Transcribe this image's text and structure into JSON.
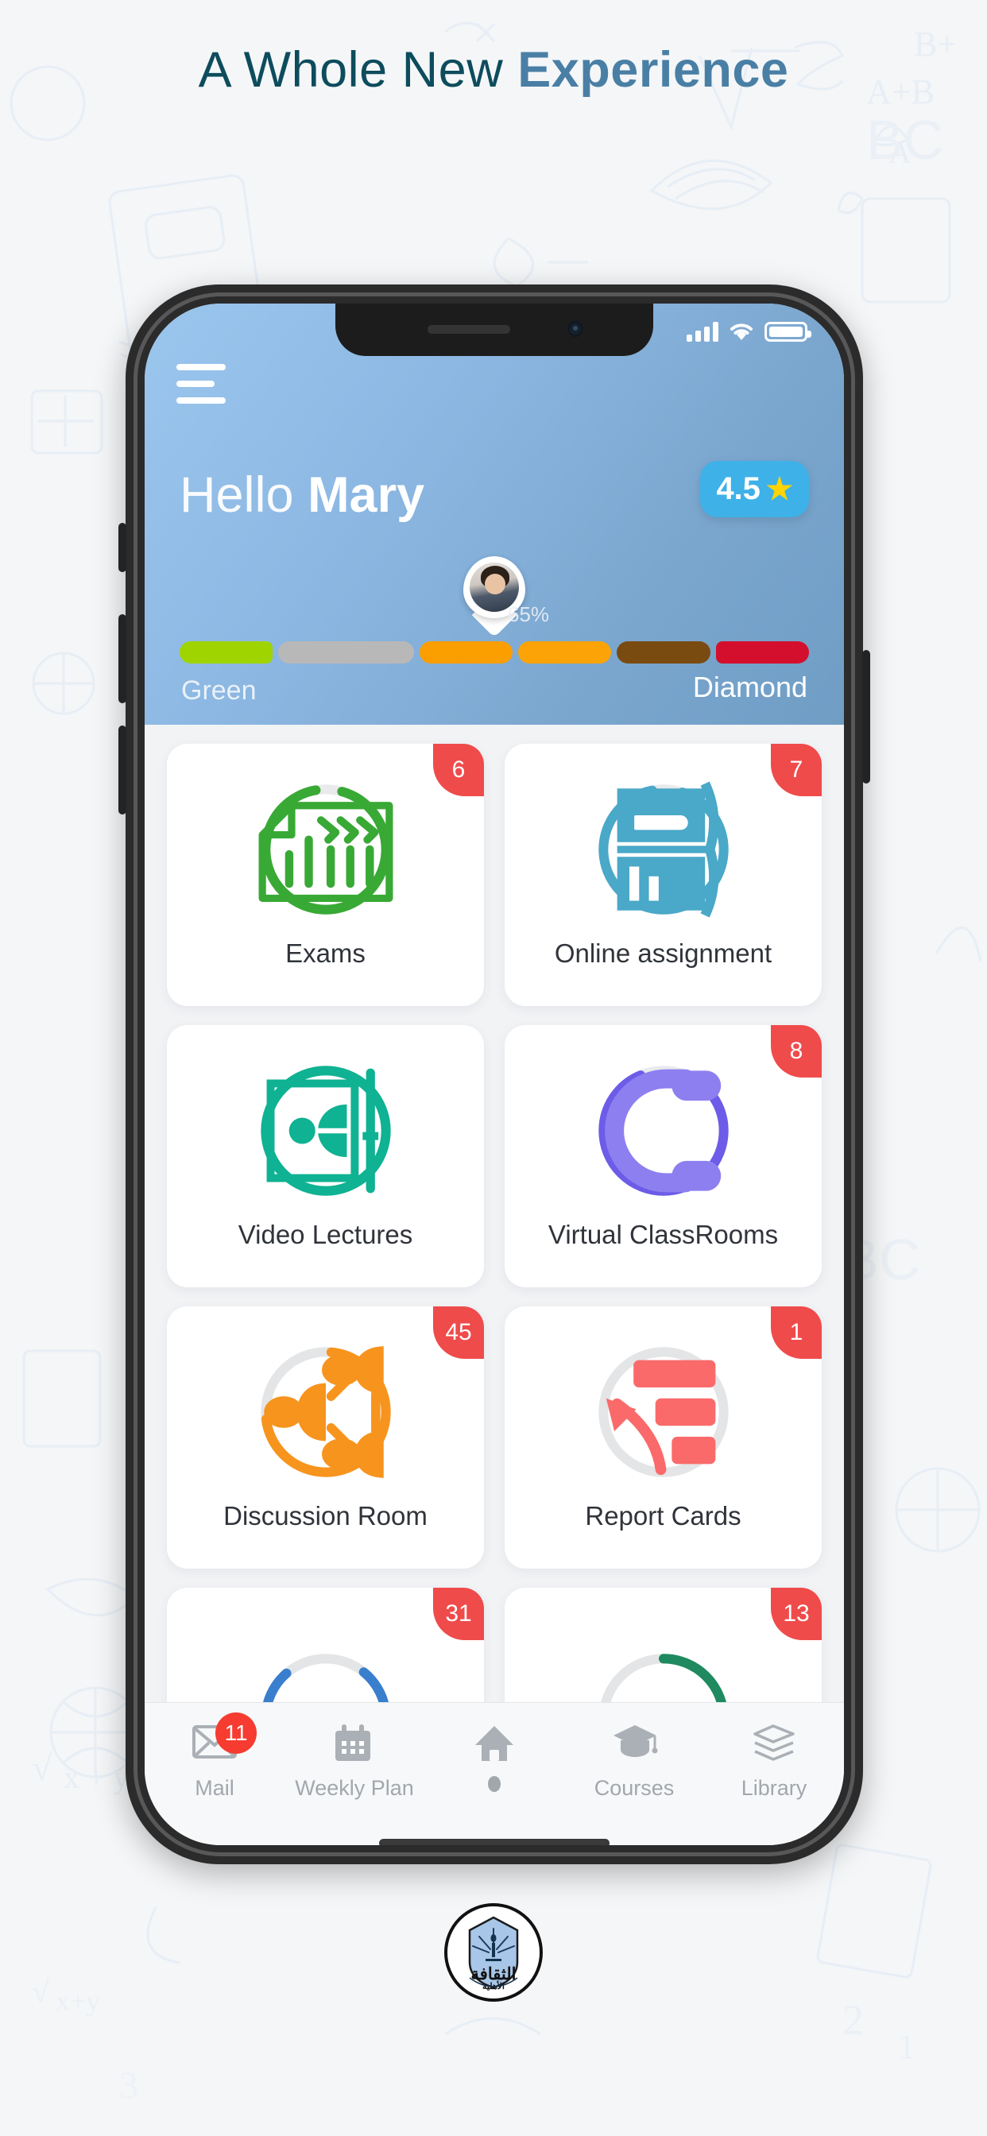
{
  "page": {
    "headline_thin": "A Whole New ",
    "headline_bold": "Experience"
  },
  "phone": {
    "status_bar": {
      "signal_icon": "signal-bars-icon",
      "wifi_icon": "wifi-icon",
      "battery_icon": "battery-full-icon"
    },
    "header": {
      "menu_icon": "hamburger-menu-icon",
      "greeting_prefix": "Hello ",
      "user_name": "Mary",
      "rating_value": "4.5",
      "rating_star_icon": "star-icon",
      "rating_bg": "#3eb1e8",
      "avatar_icon": "user-avatar-pin",
      "progress_percent": "65%",
      "rank_current": "Green",
      "rank_target": "Diamond",
      "track_segments": [
        {
          "name": "green",
          "color": "#9fd400"
        },
        {
          "name": "silver",
          "color": "#b8b8b8"
        },
        {
          "name": "orange",
          "color": "#fb9e00"
        },
        {
          "name": "orange-2",
          "color": "#fba307"
        },
        {
          "name": "bronze",
          "color": "#7a4b11"
        },
        {
          "name": "ruby",
          "color": "#d40f2e"
        }
      ]
    },
    "cards": [
      {
        "label": "Exams",
        "badge": "6",
        "color": "#39a935",
        "icon": "checklist-document-icon",
        "progress": 0.93
      },
      {
        "label": "Online assignment",
        "badge": "7",
        "color": "#4aa8c8",
        "icon": "open-book-pencil-icon",
        "progress": 0.92
      },
      {
        "label": "Video Lectures",
        "badge": "",
        "color": "#0fb292",
        "icon": "video-lecture-icon",
        "progress": 1.0
      },
      {
        "label": "Virtual ClassRooms",
        "badge": "8",
        "color": "#6c5ce7",
        "icon": "headphones-icon",
        "progress": 0.88
      },
      {
        "label": "Discussion Room",
        "badge": "45",
        "color": "#f7941e",
        "icon": "group-discussion-icon",
        "progress": 0.72
      },
      {
        "label": "Report Cards",
        "badge": "1",
        "color": "#fa6a6a",
        "icon": "bar-chart-growth-icon",
        "progress": 0.0
      },
      {
        "label": "",
        "badge": "31",
        "color": "#3a7fce",
        "icon": "partial-card-icon",
        "progress": 0.78
      },
      {
        "label": "",
        "badge": "13",
        "color": "#1f8a5f",
        "icon": "partial-card-icon",
        "progress": 0.62
      }
    ],
    "badge_color": "#ef4b4b",
    "bottom_nav": [
      {
        "label": "Mail",
        "icon": "mail-envelope-icon",
        "badge": "11",
        "active": false
      },
      {
        "label": "Weekly Plan",
        "icon": "calendar-icon",
        "badge": "",
        "active": false
      },
      {
        "label": "",
        "icon": "home-icon",
        "badge": "",
        "active": true
      },
      {
        "label": "Courses",
        "icon": "graduation-cap-icon",
        "badge": "",
        "active": false
      },
      {
        "label": "Library",
        "icon": "books-stack-icon",
        "badge": "",
        "active": false
      }
    ]
  },
  "footer": {
    "logo_icon": "school-crest-logo",
    "logo_text_main": "الثقافة",
    "logo_text_sub": "الأهلية"
  }
}
